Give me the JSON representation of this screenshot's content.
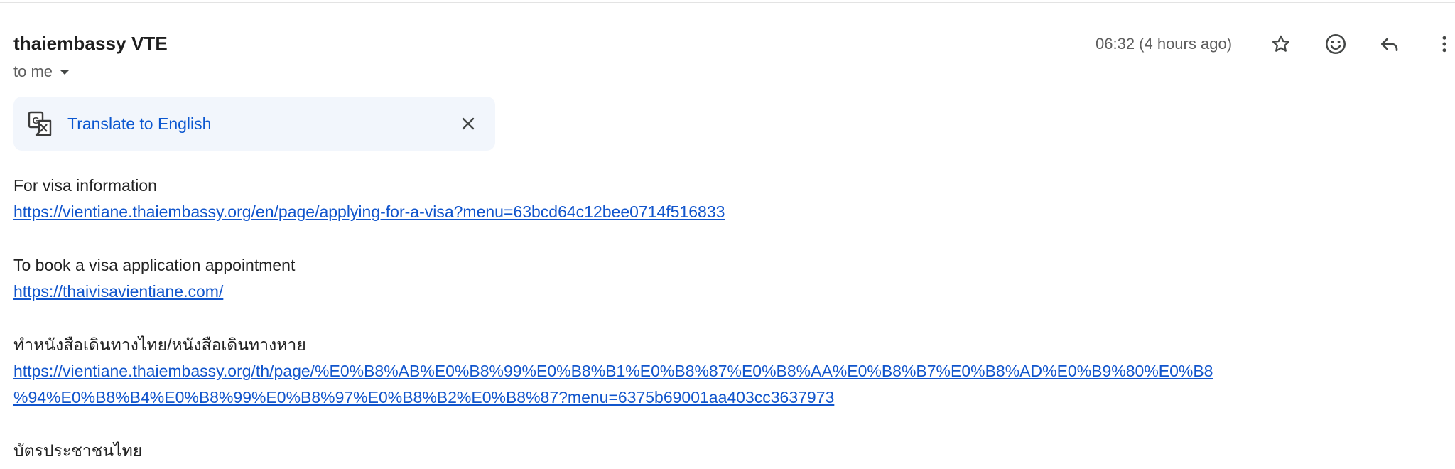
{
  "message": {
    "sender": "thaiembassy VTE",
    "recipient": "to me",
    "timestamp": "06:32 (4 hours ago)"
  },
  "header_actions": [
    {
      "icon": "star-icon",
      "label": "Star"
    },
    {
      "icon": "emoji-icon",
      "label": "Add reaction"
    },
    {
      "icon": "reply-icon",
      "label": "Reply"
    },
    {
      "icon": "more-vert-icon",
      "label": "More"
    }
  ],
  "translate_bar": {
    "icon": "translate-icon",
    "label": "Translate to English",
    "close_icon": "close-icon"
  },
  "body": {
    "visa_info_label": "For visa information",
    "visa_info_link": "https://vientiane.thaiembassy.org/en/page/applying-for-a-visa?menu=63bcd64c12bee0714f516833",
    "booking_label": "To book a visa application appointment",
    "booking_link": "https://thaivisavientiane.com/",
    "passport_label": "ทำหนังสือเดินทางไทย/หนังสือเดินทางหาย",
    "passport_link_line1": "https://vientiane.thaiembassy.org/th/page/%E0%B8%AB%E0%B8%99%E0%B8%B1%E0%B8%87%E0%B8%AA%E0%B8%B7%E0%B8%AD%E0%B9%80%E0%B8",
    "passport_link_line2": "%94%E0%B8%B4%E0%B8%99%E0%B8%97%E0%B8%B2%E0%B8%87?menu=6375b69001aa403cc3637973",
    "id_card_label": "บัตรประชาชนไทย"
  },
  "colors": {
    "link": "#1155cc",
    "translate_link": "#0b57d0",
    "translate_bg": "#f2f6fc",
    "muted_text": "#5e5e5e"
  }
}
